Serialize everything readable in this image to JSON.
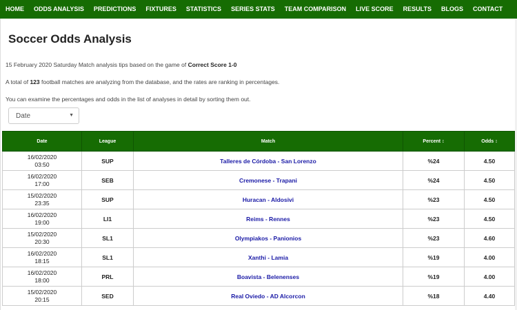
{
  "nav": {
    "items": [
      "HOME",
      "ODDS ANALYSIS",
      "PREDICTIONS",
      "FIXTURES",
      "STATISTICS",
      "SERIES STATS",
      "TEAM COMPARISON",
      "LIVE SCORE",
      "RESULTS",
      "BLOGS",
      "CONTACT"
    ]
  },
  "page": {
    "title": "Soccer Odds Analysis",
    "intro_prefix": "15 February 2020 Saturday Match analysis tips based on the game of ",
    "intro_bold": "Correct Score 1-0",
    "total_prefix": "A total of ",
    "total_count": "123",
    "total_suffix": " football matches are analyzing from the database, and the rates are ranking in percentages.",
    "examine_text": "You can examine the percentages and odds in the list of analyses in detail by sorting them out."
  },
  "sort_select": {
    "value": "Date",
    "arrow_icon": "chevron-down-icon"
  },
  "table": {
    "headers": {
      "date": "Date",
      "league": "League",
      "match": "Match",
      "percent": "Percent",
      "odds": "Odds"
    },
    "sort_icon": "↕",
    "rows": [
      {
        "date": "16/02/2020",
        "time": "03:50",
        "league": "SUP",
        "match": "Talleres de Córdoba - San Lorenzo",
        "percent": "%24",
        "odds": "4.50"
      },
      {
        "date": "16/02/2020",
        "time": "17:00",
        "league": "SEB",
        "match": "Cremonese - Trapani",
        "percent": "%24",
        "odds": "4.50"
      },
      {
        "date": "15/02/2020",
        "time": "23:35",
        "league": "SUP",
        "match": "Huracan - Aldosivi",
        "percent": "%23",
        "odds": "4.50"
      },
      {
        "date": "16/02/2020",
        "time": "19:00",
        "league": "LI1",
        "match": "Reims - Rennes",
        "percent": "%23",
        "odds": "4.50"
      },
      {
        "date": "15/02/2020",
        "time": "20:30",
        "league": "SL1",
        "match": "Olympiakos - Panionios",
        "percent": "%23",
        "odds": "4.60"
      },
      {
        "date": "16/02/2020",
        "time": "18:15",
        "league": "SL1",
        "match": "Xanthi - Lamia",
        "percent": "%19",
        "odds": "4.00"
      },
      {
        "date": "16/02/2020",
        "time": "18:00",
        "league": "PRL",
        "match": "Boavista - Belenenses",
        "percent": "%19",
        "odds": "4.00"
      },
      {
        "date": "15/02/2020",
        "time": "20:15",
        "league": "SED",
        "match": "Real Oviedo - AD Alcorcon",
        "percent": "%18",
        "odds": "4.40"
      }
    ]
  },
  "colors": {
    "nav_bg": "#166c03",
    "header_bg": "#166c03",
    "match_link": "#1a1aa6"
  }
}
